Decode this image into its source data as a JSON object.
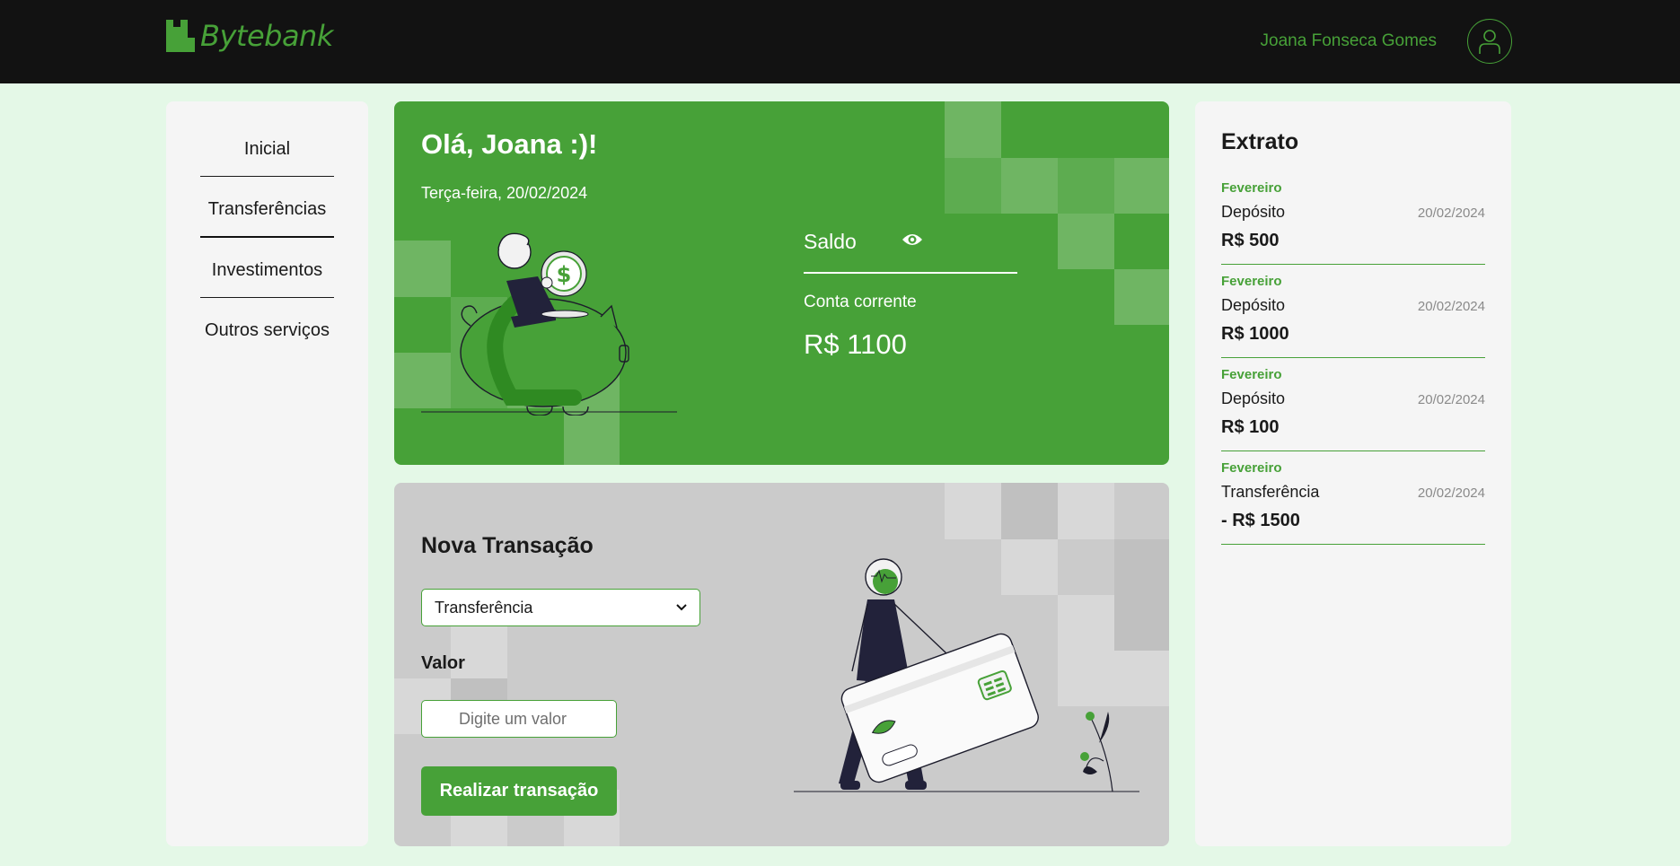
{
  "header": {
    "logo_text": "Bytebank",
    "user_name": "Joana Fonseca Gomes",
    "avatar_icon": "user-icon",
    "brand_color": "#47a138"
  },
  "sidebar": {
    "items": [
      {
        "label": "Inicial"
      },
      {
        "label": "Transferências"
      },
      {
        "label": "Investimentos"
      },
      {
        "label": "Outros serviços"
      }
    ]
  },
  "welcome": {
    "greeting": "Olá, Joana :)!",
    "date": "Terça-feira, 20/02/2024",
    "balance_label": "Saldo",
    "visibility_icon": "eye-icon",
    "account_label": "Conta corrente",
    "balance_value": "R$ 1100"
  },
  "transaction": {
    "title": "Nova Transação",
    "type_selected": "Transferência",
    "amount_label": "Valor",
    "amount_placeholder": "Digite um valor",
    "submit_label": "Realizar transação"
  },
  "statement": {
    "title": "Extrato",
    "items": [
      {
        "month": "Fevereiro",
        "type": "Depósito",
        "date": "20/02/2024",
        "amount": "R$ 500"
      },
      {
        "month": "Fevereiro",
        "type": "Depósito",
        "date": "20/02/2024",
        "amount": "R$ 1000"
      },
      {
        "month": "Fevereiro",
        "type": "Depósito",
        "date": "20/02/2024",
        "amount": "R$ 100"
      },
      {
        "month": "Fevereiro",
        "type": "Transferência",
        "date": "20/02/2024",
        "amount": "- R$ 1500"
      }
    ]
  }
}
